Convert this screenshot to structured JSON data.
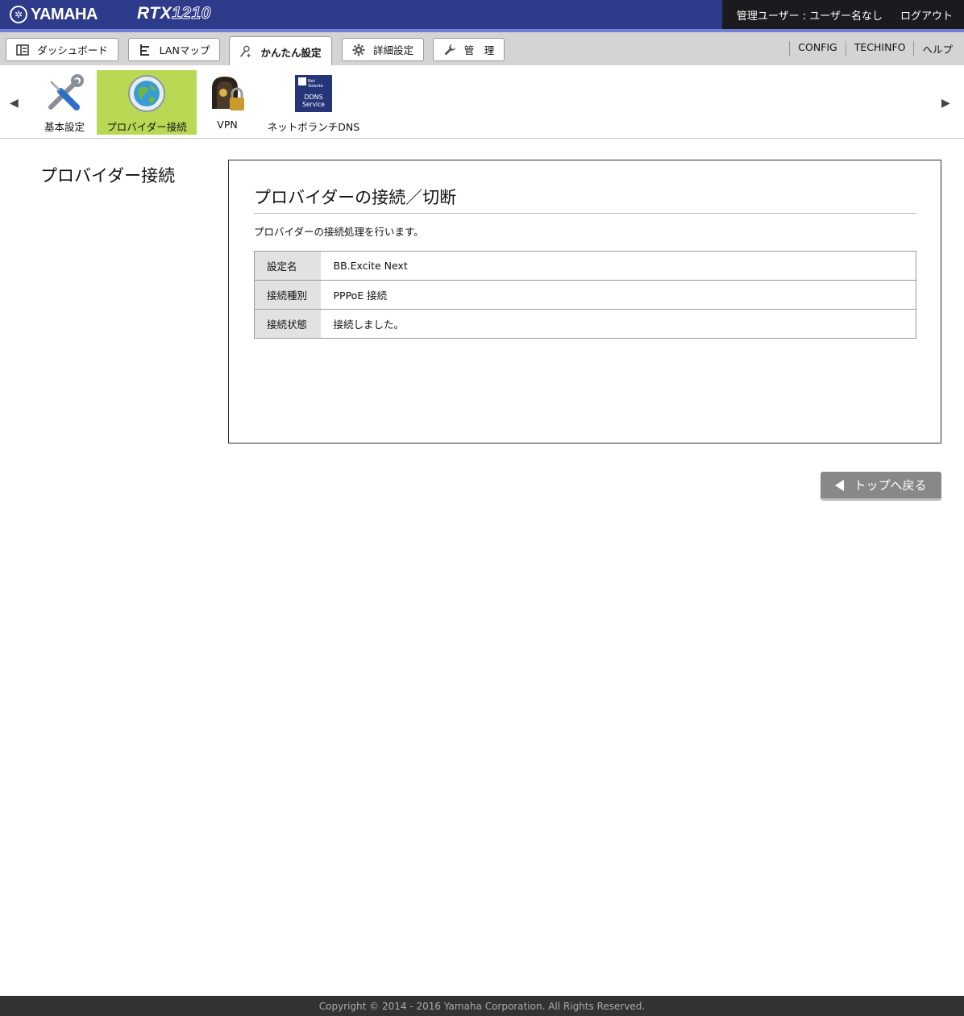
{
  "header": {
    "brand_mark": "✲",
    "brand_name": "YAMAHA",
    "model_prefix": "RTX",
    "model_number": "1210",
    "user_label": "管理ユーザー : ユーザー名なし",
    "logout_label": "ログアウト",
    "colors": {
      "bar": "#2e3a8a",
      "accent_line": "#6f7fd6",
      "user_box": "#1b1b1f"
    }
  },
  "tabs": [
    {
      "label": "ダッシュボード",
      "icon": "dashboard-icon"
    },
    {
      "label": "LANマップ",
      "icon": "lan-map-icon"
    },
    {
      "label": "かんたん設定",
      "icon": "easy-setup-icon",
      "active": true
    },
    {
      "label": "詳細設定",
      "icon": "gear-icon"
    },
    {
      "label": "管　理",
      "icon": "wrench-icon"
    }
  ],
  "toplinks": [
    "CONFIG",
    "TECHINFO",
    "ヘルプ"
  ],
  "submenu": {
    "prev_arrow": "◀",
    "next_arrow": "▶",
    "items": [
      {
        "label": "基本設定",
        "icon": "tools-icon"
      },
      {
        "label": "プロバイダー接続",
        "icon": "globe-icon",
        "active": true
      },
      {
        "label": "VPN",
        "icon": "vpn-lock-icon"
      },
      {
        "label": "ネットボランチDNS",
        "icon": "ddns-service-icon"
      }
    ],
    "ddns_icon_text": [
      "Net",
      "Volante",
      "DDNS",
      "Service"
    ],
    "active_color": "#b9d954"
  },
  "page": {
    "side_title": "プロバイダー接続",
    "panel_title": "プロバイダーの接続／切断",
    "description": "プロバイダーの接続処理を行います。",
    "rows": [
      {
        "key": "設定名",
        "value": "BB.Excite Next"
      },
      {
        "key": "接続種別",
        "value": "PPPoE 接続"
      },
      {
        "key": "接続状態",
        "value": "接続しました。"
      }
    ],
    "back_label": "トップへ戻る"
  },
  "footer": {
    "copyright": "Copyright © 2014 - 2016 Yamaha Corporation. All Rights Reserved."
  }
}
